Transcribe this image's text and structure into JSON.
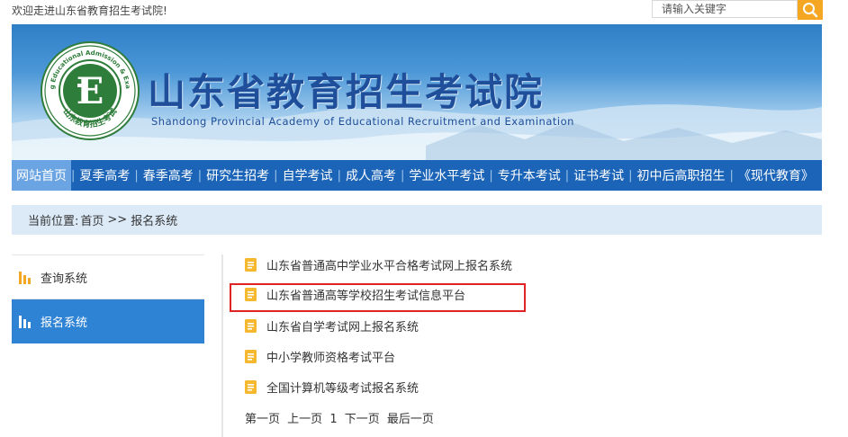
{
  "topbar": {
    "welcome_text": "欢迎走进山东省教育招生考试院!",
    "search_placeholder": "请输入关键字"
  },
  "banner": {
    "title_cn": "山东省教育招生考试院",
    "title_en": "Shandong Provincial Academy of Educational Recruitment and Examination",
    "logo_ring_text_en": "Shandong Educational Admission & Examination",
    "logo_ring_text_cn": "山东教育招生考试"
  },
  "nav": {
    "items": [
      {
        "label": "网站首页",
        "active": true
      },
      {
        "label": "夏季高考"
      },
      {
        "label": "春季高考"
      },
      {
        "label": "研究生招考"
      },
      {
        "label": "自学考试"
      },
      {
        "label": "成人高考"
      },
      {
        "label": "学业水平考试"
      },
      {
        "label": "专升本考试"
      },
      {
        "label": "证书考试"
      },
      {
        "label": "初中后高职招生"
      },
      {
        "label": "《现代教育》"
      }
    ]
  },
  "breadcrumb": {
    "prefix": "当前位置:",
    "home": "首页",
    "separator": ">>",
    "current": "报名系统"
  },
  "sidebar": {
    "items": [
      {
        "label": "查询系统",
        "active": false
      },
      {
        "label": "报名系统",
        "active": true
      }
    ]
  },
  "list": {
    "items": [
      {
        "text": "山东省普通高中学业水平合格考试网上报名系统"
      },
      {
        "text": "山东省普通高等学校招生考试信息平台",
        "highlighted": true
      },
      {
        "text": "山东省自学考试网上报名系统"
      },
      {
        "text": "中小学教师资格考试平台"
      },
      {
        "text": "全国计算机等级考试报名系统"
      }
    ]
  },
  "pager": {
    "first": "第一页",
    "prev": "上一页",
    "page": "1",
    "next": "下一页",
    "last": "最后一页"
  },
  "colors": {
    "nav_bg": "#1b64b8",
    "nav_active": "#6ba4e3",
    "sidebar_active": "#2f83d4",
    "search_button": "#f5a623",
    "list_icon": "#f5b82e",
    "highlight_border": "#e02424",
    "breadcrumb_bg": "#dceaf8"
  },
  "icons": {
    "search": "magnifier-icon",
    "sidebar": "bar-chart-icon",
    "list": "document-icon"
  }
}
